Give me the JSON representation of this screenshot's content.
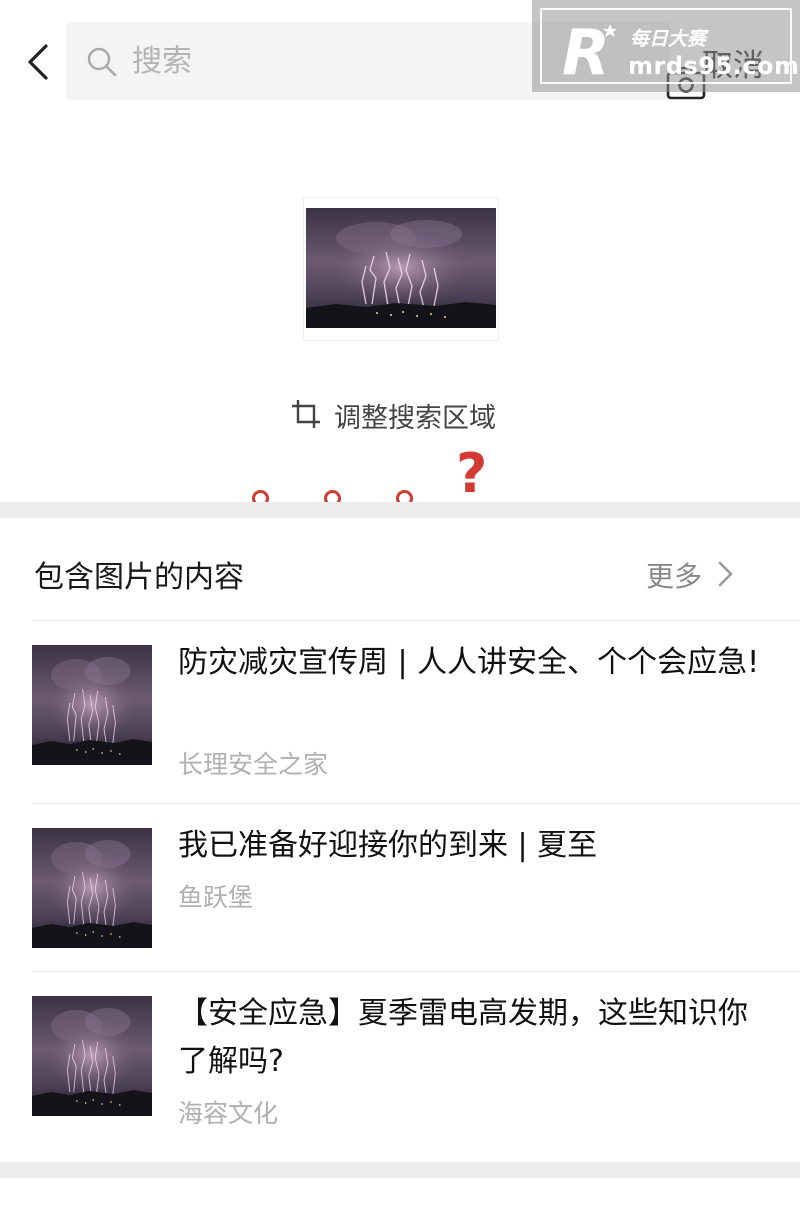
{
  "search": {
    "placeholder": "搜索",
    "cancel_label": "取消"
  },
  "watermark": {
    "logo_text": "R",
    "brand_cn": "每日大赛",
    "url_text": "mrds95.com"
  },
  "query": {
    "adjust_label": "调整搜索区域"
  },
  "annotation": {
    "question_mark": "?",
    "color": "#d33a33"
  },
  "results": {
    "section_title": "包含图片的内容",
    "more_label": "更多",
    "items": [
      {
        "title": "防灾减灾宣传周 | 人人讲安全、个个会应急!",
        "source": "长理安全之家"
      },
      {
        "title": "我已准备好迎接你的到来 | 夏至",
        "source": "鱼跃堡"
      },
      {
        "title": "【安全应急】夏季雷电高发期，这些知识你了解吗?",
        "source": "海容文化"
      }
    ]
  },
  "icons": {
    "back": "chevron-left-icon",
    "search": "search-icon",
    "camera": "camera-icon",
    "crop": "crop-icon",
    "more": "chevron-right-icon"
  },
  "colors": {
    "divider": "#ededed",
    "secondary_text": "#b0b0b0",
    "more_text": "#888888"
  }
}
